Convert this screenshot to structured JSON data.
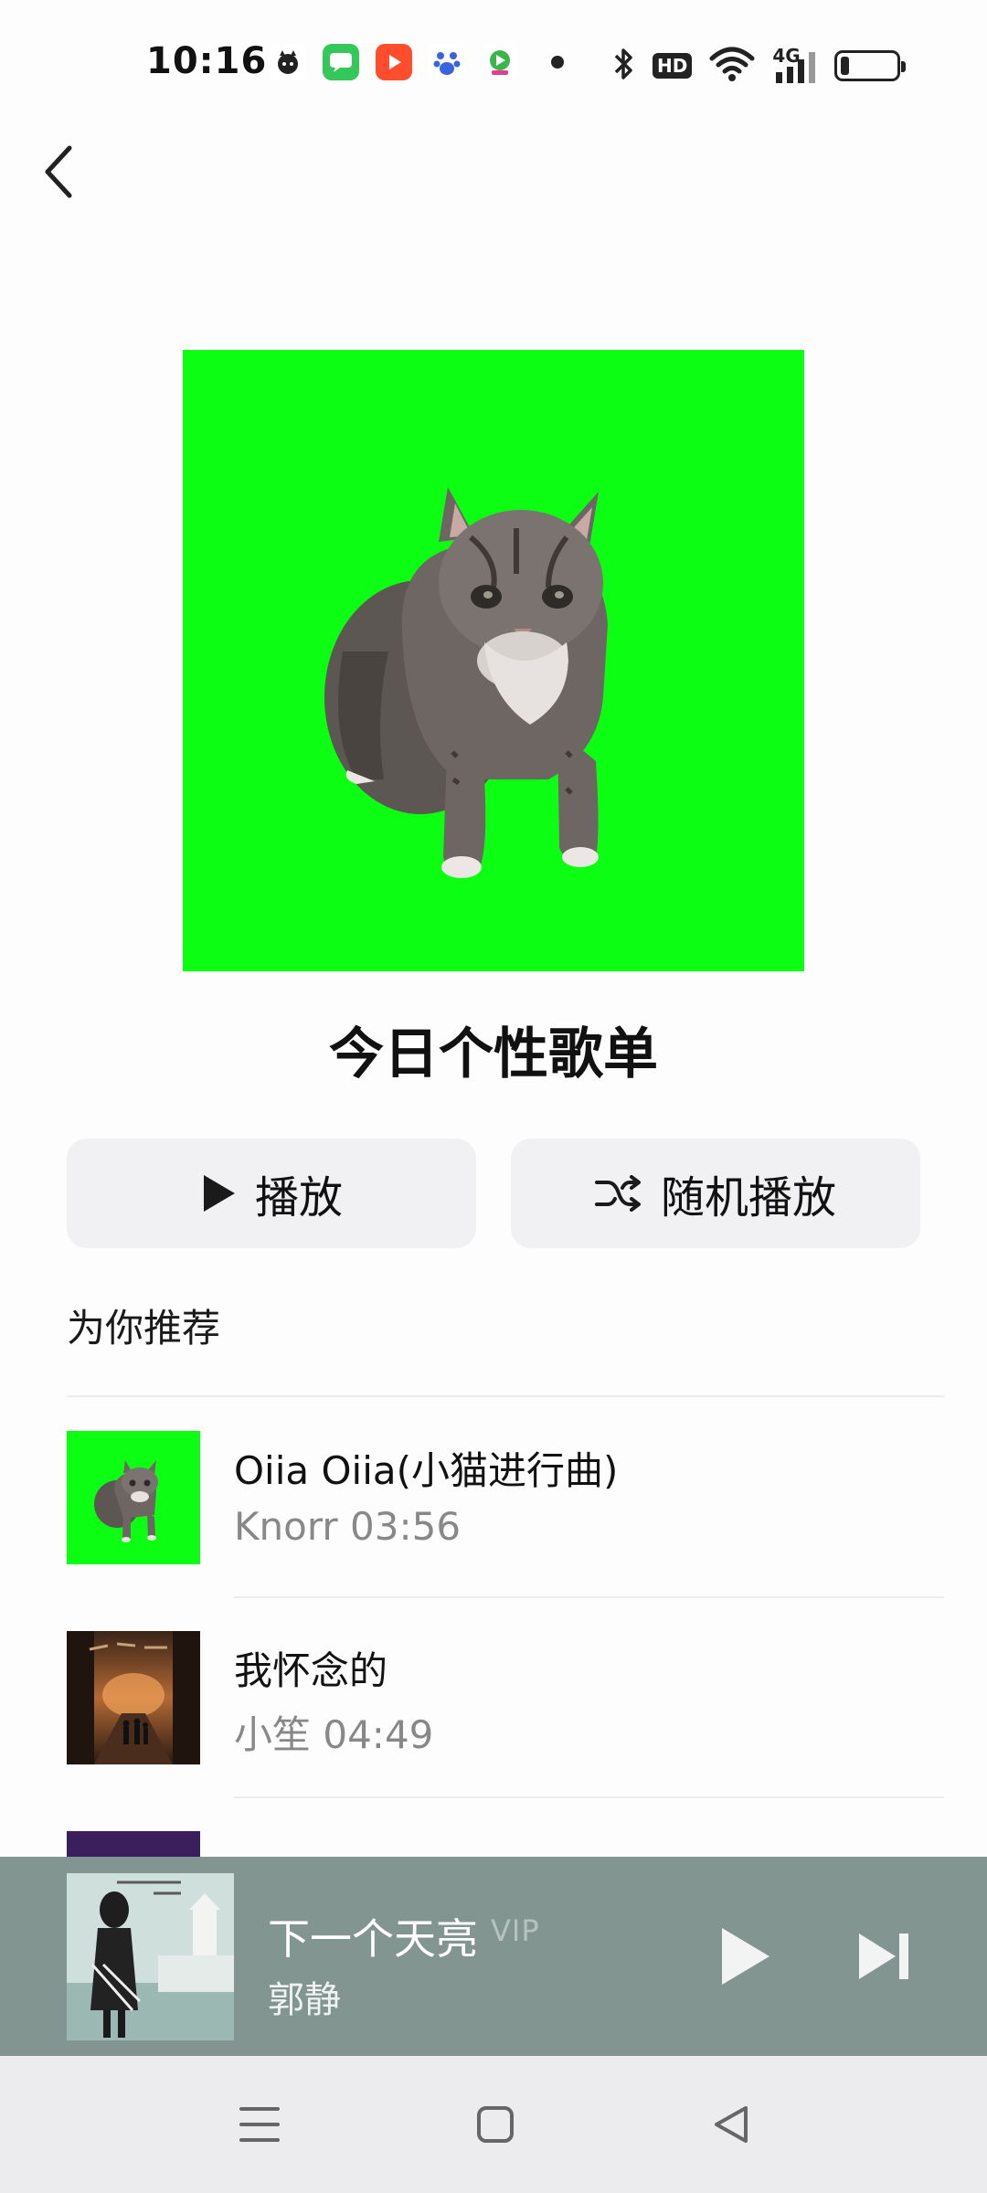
{
  "status_bar": {
    "time": "10:16",
    "network_label": "4G",
    "hd_label": "HD",
    "notification_icons": [
      "cat-app-icon",
      "message-icon",
      "video-app-icon",
      "baidu-icon",
      "media-app-icon"
    ],
    "system_icons": [
      "bluetooth-icon",
      "hd-icon",
      "wifi-icon",
      "signal-icon",
      "battery-icon"
    ],
    "battery_level": 0.15
  },
  "playlist": {
    "title": "今日个性歌单",
    "cover_bg": "#0cff12"
  },
  "actions": {
    "play_label": "播放",
    "shuffle_label": "随机播放"
  },
  "section": {
    "title": "为你推荐"
  },
  "songs": [
    {
      "title": "Oiia Oiia(小猫进行曲)",
      "artist_duration": "Knorr 03:56"
    },
    {
      "title": "我怀念的",
      "artist_duration": "小笙  04:49"
    }
  ],
  "mini_player": {
    "title": "下一个天亮",
    "badge": "VIP",
    "artist": "郭静",
    "bg_color": "#839590"
  },
  "nav_bar": {
    "buttons": [
      "menu-icon",
      "home-icon",
      "back-triangle-icon"
    ]
  },
  "colors": {
    "accent_green": "#0cff12",
    "button_bg": "#f1f1f3",
    "muted_text": "#888888"
  }
}
